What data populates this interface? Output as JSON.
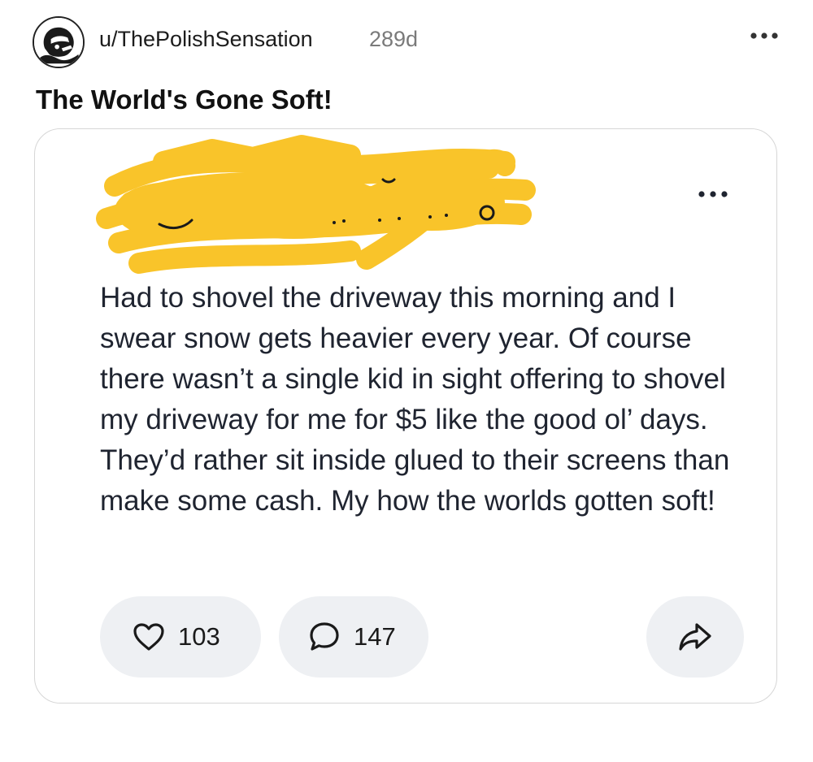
{
  "header": {
    "avatar_icon": "avatar-icon",
    "username": "u/ThePolishSensation",
    "age": "289d",
    "more_icon": "more-horizontal-icon"
  },
  "post": {
    "title": "The World's Gone Soft!"
  },
  "card": {
    "redaction_icon": "redaction-scribble",
    "more_icon": "more-horizontal-icon",
    "body": "Had to shovel the driveway this morning and I swear snow gets heavier every year. Of course there wasn’t a single kid in sight offering to shovel my driveway for me for $5 like the good ol’ days. They’d rather sit inside glued to their screens than make some cash. My how the worlds gotten soft!",
    "actions": {
      "likes": "103",
      "comments": "147",
      "like_icon": "heart-icon",
      "comment_icon": "comment-bubble-icon",
      "share_icon": "share-arrow-icon"
    }
  },
  "colors": {
    "redaction": "#F9C42A",
    "pill_bg": "#EEF0F3",
    "body_text": "#1F2430",
    "muted": "#7A7A7A"
  }
}
